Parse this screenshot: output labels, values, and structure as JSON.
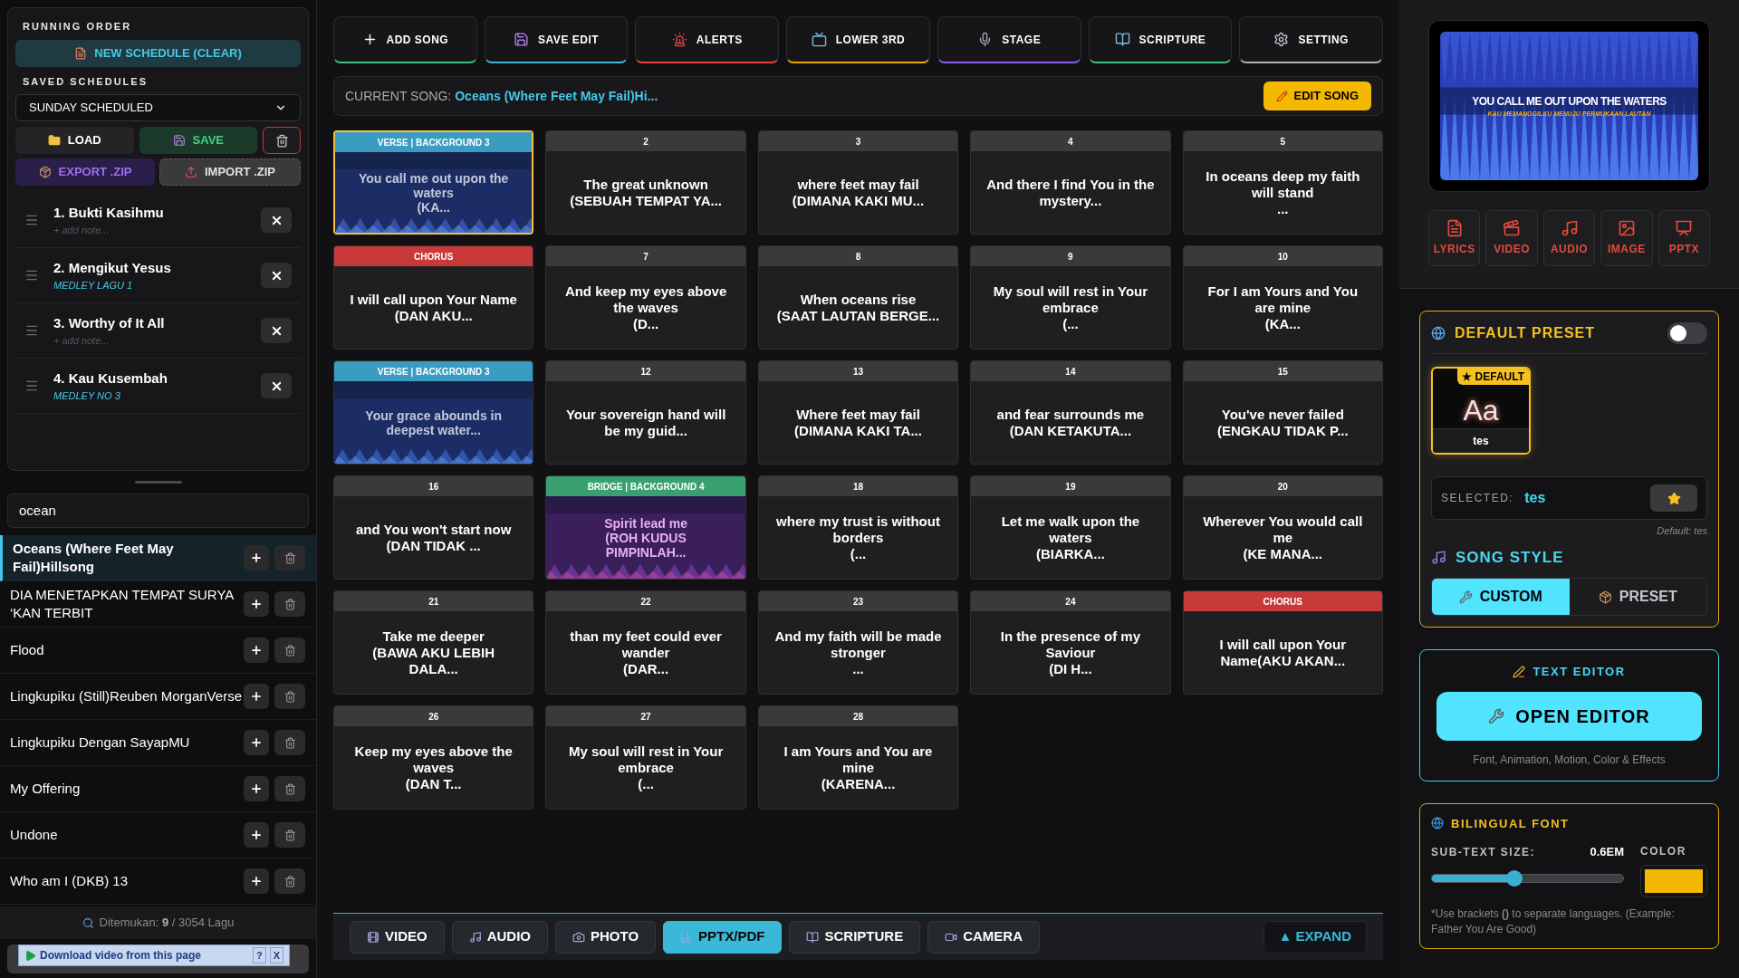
{
  "running_order": {
    "title": "RUNNING ORDER",
    "new_button": "NEW SCHEDULE (CLEAR)",
    "saved_label": "SAVED SCHEDULES",
    "saved_value": "SUNDAY SCHEDULED",
    "load": "LOAD",
    "save": "SAVE",
    "export": "EXPORT .ZIP",
    "import": "IMPORT .ZIP",
    "items": [
      {
        "title": "1. Bukti Kasihmu",
        "note": "+ add note...",
        "has_note": false
      },
      {
        "title": "2. Mengikut Yesus",
        "note": "MEDLEY LAGU 1",
        "has_note": true
      },
      {
        "title": "3. Worthy of It All",
        "note": "+ add note...",
        "has_note": false
      },
      {
        "title": "4. Kau Kusembah",
        "note": "MEDLEY NO 3",
        "has_note": true
      }
    ]
  },
  "library": {
    "search_value": "ocean",
    "results": [
      {
        "title": "Oceans (Where Feet May Fail)Hillsong",
        "selected": true
      },
      {
        "title": "DIA MENETAPKAN TEMPAT SURYA ‘KAN TERBIT",
        "selected": false
      },
      {
        "title": "Flood",
        "selected": false
      },
      {
        "title": "Lingkupiku (Still)Reuben MorganVerse",
        "selected": false
      },
      {
        "title": "Lingkupiku Dengan SayapMU",
        "selected": false
      },
      {
        "title": "My Offering",
        "selected": false
      },
      {
        "title": "Undone",
        "selected": false
      },
      {
        "title": "Who am I (DKB) 13",
        "selected": false
      }
    ],
    "found_label": "Ditemukan:",
    "found_count": "9",
    "found_total": "/ 3054 Lagu"
  },
  "download_bar": {
    "label": "Download video from this page",
    "help": "?",
    "close": "X"
  },
  "toolbar": [
    {
      "label": "ADD SONG",
      "color": "#3fbf7f"
    },
    {
      "label": "SAVE EDIT",
      "color": "#3fb8d8"
    },
    {
      "label": "ALERTS",
      "color": "#e04040"
    },
    {
      "label": "LOWER 3RD",
      "color": "#e8a800"
    },
    {
      "label": "STAGE",
      "color": "#8a5cf0"
    },
    {
      "label": "SCRIPTURE",
      "color": "#3fbf7f"
    },
    {
      "label": "SETTING",
      "color": "#b0b0b0"
    }
  ],
  "current_song": {
    "label": "CURRENT SONG:",
    "title": "Oceans (Where Feet May Fail)Hi...",
    "edit_button": "EDIT SONG"
  },
  "slides": [
    {
      "header": "VERSE | BACKGROUND 3",
      "kind": "verse",
      "background": true,
      "selected": true,
      "text": "You call me out upon the waters\n(KA..."
    },
    {
      "header": "2",
      "kind": "plain",
      "background": false,
      "selected": false,
      "text": "The great unknown\n(SEBUAH TEMPAT YA..."
    },
    {
      "header": "3",
      "kind": "plain",
      "background": false,
      "selected": false,
      "text": "where feet may fail\n(DIMANA KAKI MU..."
    },
    {
      "header": "4",
      "kind": "plain",
      "background": false,
      "selected": false,
      "text": "And there I find You in the mystery..."
    },
    {
      "header": "5",
      "kind": "plain",
      "background": false,
      "selected": false,
      "text": "In oceans deep my faith will stand\n..."
    },
    {
      "header": "CHORUS",
      "kind": "chorus",
      "background": false,
      "selected": false,
      "text": "I will call upon Your Name\n(DAN AKU..."
    },
    {
      "header": "7",
      "kind": "plain",
      "background": false,
      "selected": false,
      "text": "And keep my eyes above the waves\n(D..."
    },
    {
      "header": "8",
      "kind": "plain",
      "background": false,
      "selected": false,
      "text": "When oceans rise\n(SAAT LAUTAN BERGE..."
    },
    {
      "header": "9",
      "kind": "plain",
      "background": false,
      "selected": false,
      "text": "My soul will rest in Your embrace\n(..."
    },
    {
      "header": "10",
      "kind": "plain",
      "background": false,
      "selected": false,
      "text": "For I am Yours and You are mine\n(KA..."
    },
    {
      "header": "VERSE | BACKGROUND 3",
      "kind": "verse",
      "background": true,
      "selected": false,
      "text": "Your grace abounds in deepest water..."
    },
    {
      "header": "12",
      "kind": "plain",
      "background": false,
      "selected": false,
      "text": "Your sovereign hand will be my guid..."
    },
    {
      "header": "13",
      "kind": "plain",
      "background": false,
      "selected": false,
      "text": "Where feet may fail\n(DIMANA KAKI TA..."
    },
    {
      "header": "14",
      "kind": "plain",
      "background": false,
      "selected": false,
      "text": "and fear surrounds me\n(DAN KETAKUTA..."
    },
    {
      "header": "15",
      "kind": "plain",
      "background": false,
      "selected": false,
      "text": "You've never failed\n(ENGKAU TIDAK P..."
    },
    {
      "header": "16",
      "kind": "plain",
      "background": false,
      "selected": false,
      "text": "and You won't start now\n(DAN TIDAK ..."
    },
    {
      "header": "BRIDGE | BACKGROUND 4",
      "kind": "bridge",
      "background": true,
      "selected": false,
      "text": "Spirit lead me\n(ROH KUDUS PIMPINLAH..."
    },
    {
      "header": "18",
      "kind": "plain",
      "background": false,
      "selected": false,
      "text": "where my trust is without borders\n(..."
    },
    {
      "header": "19",
      "kind": "plain",
      "background": false,
      "selected": false,
      "text": "Let me walk upon the waters\n(BIARKA..."
    },
    {
      "header": "20",
      "kind": "plain",
      "background": false,
      "selected": false,
      "text": "Wherever You would call me\n(KE MANA..."
    },
    {
      "header": "21",
      "kind": "plain",
      "background": false,
      "selected": false,
      "text": "Take me deeper\n(BAWA AKU LEBIH DALA..."
    },
    {
      "header": "22",
      "kind": "plain",
      "background": false,
      "selected": false,
      "text": "than my feet could ever wander\n(DAR..."
    },
    {
      "header": "23",
      "kind": "plain",
      "background": false,
      "selected": false,
      "text": "And my faith will be made stronger\n..."
    },
    {
      "header": "24",
      "kind": "plain",
      "background": false,
      "selected": false,
      "text": "In the presence of my Saviour\n(DI H..."
    },
    {
      "header": "CHORUS",
      "kind": "chorus",
      "background": false,
      "selected": false,
      "text": "I will call upon Your Name(AKU AKAN..."
    },
    {
      "header": "26",
      "kind": "plain",
      "background": false,
      "selected": false,
      "text": "Keep my eyes above the waves\n(DAN T..."
    },
    {
      "header": "27",
      "kind": "plain",
      "background": false,
      "selected": false,
      "text": "My soul will rest in Your embrace\n(..."
    },
    {
      "header": "28",
      "kind": "plain",
      "background": false,
      "selected": false,
      "text": "I am Yours and You are mine\n(KARENA..."
    }
  ],
  "media_tabs": [
    {
      "label": "VIDEO",
      "selected": false
    },
    {
      "label": "AUDIO",
      "selected": false
    },
    {
      "label": "PHOTO",
      "selected": false
    },
    {
      "label": "PPTX/PDF",
      "selected": true
    },
    {
      "label": "SCRIPTURE",
      "selected": false
    },
    {
      "label": "CAMERA",
      "selected": false
    }
  ],
  "expand_button": "▲ EXPAND",
  "preview": {
    "line": "YOU CALL ME OUT UPON THE WATERS",
    "subline": "KAU MEMANGGILKU MENUJU PERMUKAAN LAUTAN"
  },
  "media_buttons": [
    "LYRICS",
    "VIDEO",
    "AUDIO",
    "IMAGE",
    "PPTX"
  ],
  "default_preset": {
    "title": "DEFAULT PRESET",
    "on": false,
    "tile_badge": "★ DEFAULT",
    "tile_sample": "Aa",
    "tile_name": "tes",
    "selected_label": "SELECTED:",
    "selected_value": "tes",
    "default_note": "Default: tes"
  },
  "song_style": {
    "title": "SONG STYLE",
    "tabs": [
      {
        "label": "CUSTOM",
        "selected": true
      },
      {
        "label": "PRESET",
        "selected": false
      }
    ]
  },
  "text_editor": {
    "title": "TEXT EDITOR",
    "button": "OPEN EDITOR",
    "caption": "Font, Animation, Motion, Color & Effects"
  },
  "bilingual": {
    "title": "BILINGUAL FONT",
    "size_label": "SUB-TEXT SIZE:",
    "size_value": "0.6EM",
    "color_label": "COLOR",
    "level": 0.43,
    "color": "#f5b800",
    "note": "*Use brackets **()** to separate languages. (Example: Father You Are Good)"
  }
}
